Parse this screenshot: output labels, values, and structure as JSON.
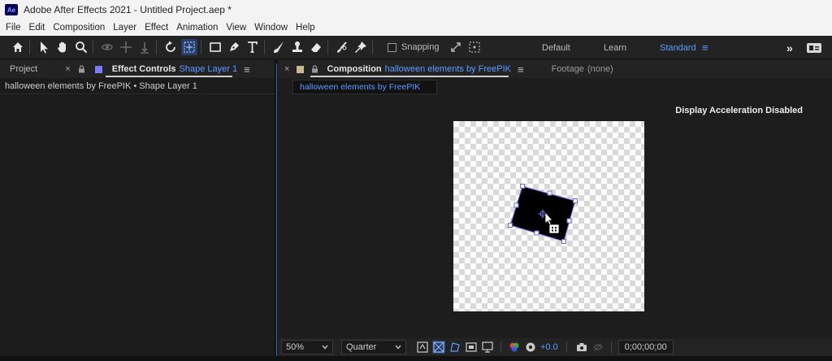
{
  "window": {
    "title": "Adobe After Effects 2021 - Untitled Project.aep *",
    "logo_text": "Ae"
  },
  "menu": [
    "File",
    "Edit",
    "Composition",
    "Layer",
    "Effect",
    "Animation",
    "View",
    "Window",
    "Help"
  ],
  "toolbar": {
    "snapping_label": "Snapping",
    "workspaces": [
      "Default",
      "Learn",
      "Standard"
    ],
    "active_workspace": "Standard",
    "overflow_label": "»"
  },
  "left_panel": {
    "project_tab": "Project",
    "effect_controls_tab": "Effect Controls",
    "effect_controls_layer": "Shape Layer 1",
    "subheader": "halloween elements by FreePIK • Shape Layer 1"
  },
  "right_panel": {
    "composition_tab": "Composition",
    "composition_name": "halloween elements by FreePIK",
    "footage_tab": "Footage",
    "footage_value": "(none)",
    "breadcrumb": "halloween elements by FreePIK",
    "acceleration_notice": "Display Acceleration Disabled"
  },
  "viewer_bar": {
    "zoom": "50%",
    "resolution": "Quarter",
    "exposure": "+0.0",
    "timecode": "0;00;00;00"
  },
  "colors": {
    "accent_blue": "#5b9bff",
    "effect_controls_swatch": "#7b7bff",
    "composition_swatch": "#c8b98a"
  },
  "close_glyph": "×",
  "menu_glyph": "≡"
}
